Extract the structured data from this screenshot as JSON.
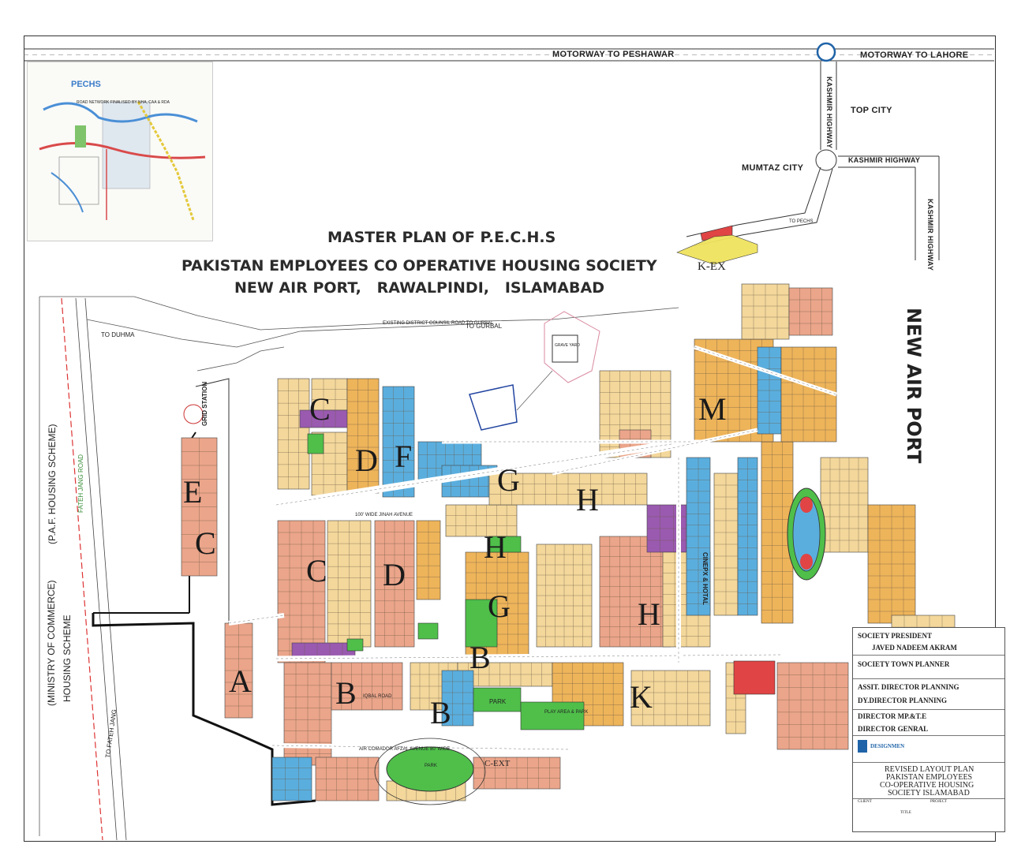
{
  "titles": {
    "master_plan": "MASTER PLAN OF P.E.C.H.S",
    "society_name": "PAKISTAN EMPLOYEES CO OPERATIVE HOUSING SOCIETY",
    "location": "NEW AIR PORT,   RAWALPINDI,   ISLAMABAD"
  },
  "roads": {
    "motorway_peshawar": "MOTORWAY TO PESHAWAR",
    "motorway_lahore": "MOTORWAY TO LAHORE",
    "kashmir_highway": "KASHMIR HIGHWAY",
    "to_duhma": "TO DUHMA",
    "to_gurbal": "TO GURBAL",
    "fateh_jang_road": "FATEH JANG ROAD",
    "to_fateh_jang": "TO FATEH JANG",
    "air_comador_avenue": "AIR COMADOR AFZAL AVENUE 80' WIDE",
    "iqbal_road": "IQBAL ROAD",
    "jinah_avenue": "100' WIDE JINAH AVENUE",
    "to_pechs": "TO PECHS",
    "district_council_road": "EXISTING DISTRICT COUNSIL ROAD TO GURBAL"
  },
  "places": {
    "top_city": "TOP CITY",
    "mumtaz_city": "MUMTAZ CITY",
    "new_air_port": "NEW AIR PORT",
    "paf_scheme": "(P.A.F. HOUSING SCHEME)",
    "commerce_scheme_1": "(MINISTRY OF  COMMERCE)",
    "commerce_scheme_2": "HOUSING SCHEME",
    "grid_station": "GRID STATION",
    "grave_yard": "GRAVE YARD",
    "park": "PARK",
    "park_2": "PARK",
    "play_area": "PLAY AREA & PARK",
    "c_ext": "C-EXT",
    "k_ex": "K-EX",
    "cinepex": "CINEPX & HOTAL"
  },
  "sectors": [
    "A",
    "B",
    "B",
    "B",
    "C",
    "C",
    "C",
    "D",
    "D",
    "E",
    "F",
    "G",
    "G",
    "H",
    "H",
    "H",
    "K",
    "M"
  ],
  "inset": {
    "title": "PECHS",
    "caption": "ROAD NETWORK FINALISED BY NHA, CAA & RDA"
  },
  "title_block": {
    "president_label": "SOCIETY PRESIDENT",
    "president_name": "JAVED NADEEM AKRAM",
    "town_planner": "SOCIETY TOWN PLANNER",
    "assit_director": "ASSIT.  DIRECTOR  PLANNING",
    "dy_director": "DY.DIRECTOR PLANNING",
    "director_mpte": "DIRECTOR MP.&T.E",
    "director_genral": "DIRECTOR GENRAL",
    "consultant": "DESIGNMEN",
    "revised_1": "REVISED LAYOUT PLAN",
    "revised_2": "PAKISTAN EMPLOYEES",
    "revised_3": "CO-OPERATIVE HOUSING",
    "revised_4": "SOCIETY ISLAMABAD",
    "client_label": "CLIENT",
    "project_label": "PROJECT",
    "title_label": "TITLE"
  },
  "colors": {
    "residential_light": "#f3d79b",
    "residential_orange": "#eeb45a",
    "residential_salmon": "#eba58a",
    "blue_plots": "#5aaede",
    "purple_plots": "#9a5ab0",
    "green_parks": "#4fbf4a",
    "red_plots": "#e04444",
    "yellow_plots": "#f0e35e"
  }
}
